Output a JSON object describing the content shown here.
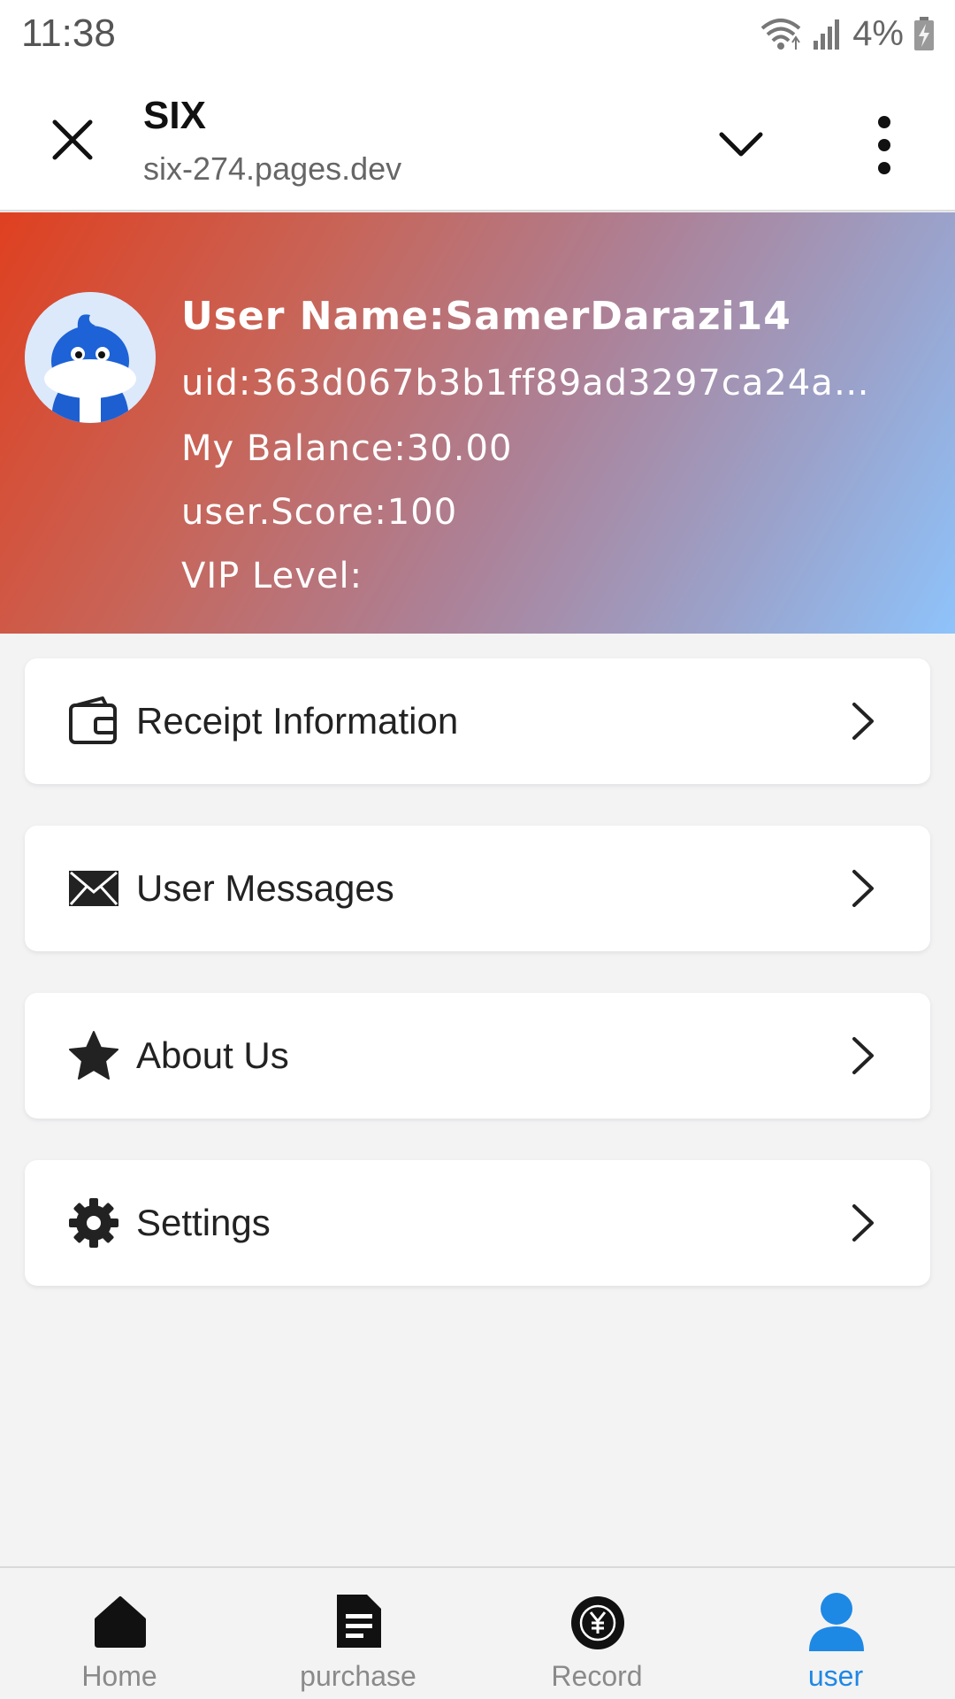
{
  "status_bar": {
    "time": "11:38",
    "battery": "4%"
  },
  "browser": {
    "title": "SIX",
    "url": "six-274.pages.dev"
  },
  "profile": {
    "user_name": "User Name:SamerDarazi14",
    "uid": "uid:363d067b3b1ff89ad3297ca24a…",
    "balance": "My Balance:30.00",
    "score": "user.Score:100",
    "vip": "VIP Level:"
  },
  "menu": [
    {
      "label": "Receipt Information",
      "icon": "wallet-icon"
    },
    {
      "label": "User Messages",
      "icon": "envelope-icon"
    },
    {
      "label": "About Us",
      "icon": "star-icon"
    },
    {
      "label": "Settings",
      "icon": "gear-icon"
    }
  ],
  "nav": [
    {
      "label": "Home",
      "icon": "home-icon",
      "active": false
    },
    {
      "label": "purchase",
      "icon": "document-icon",
      "active": false
    },
    {
      "label": "Record",
      "icon": "yuan-coin-icon",
      "active": false
    },
    {
      "label": "user",
      "icon": "user-icon",
      "active": true
    }
  ],
  "colors": {
    "accent": "#1e88e5",
    "gradient_start": "#df4020",
    "gradient_end": "#8ec3fb"
  }
}
